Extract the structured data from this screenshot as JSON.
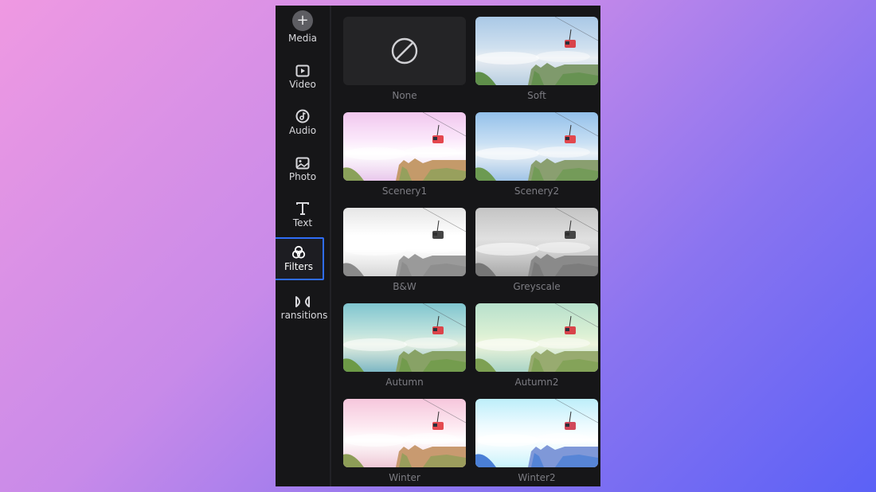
{
  "sidebar": {
    "items": [
      {
        "id": "media",
        "label": "Media",
        "icon": "plus-circle-icon"
      },
      {
        "id": "video",
        "label": "Video",
        "icon": "video-play-icon"
      },
      {
        "id": "audio",
        "label": "Audio",
        "icon": "music-note-icon"
      },
      {
        "id": "photo",
        "label": "Photo",
        "icon": "image-icon"
      },
      {
        "id": "text",
        "label": "Text",
        "icon": "text-t-icon"
      },
      {
        "id": "filters",
        "label": "Filters",
        "icon": "filters-circles-icon",
        "active": true
      },
      {
        "id": "transitions",
        "label": "Transitions",
        "display": "ransitions",
        "icon": "bowtie-transition-icon"
      }
    ],
    "active_color": "#2f6df6"
  },
  "filters": [
    {
      "label": "None",
      "icon": "no-filter-icon"
    },
    {
      "label": "Soft"
    },
    {
      "label": "Scenery1"
    },
    {
      "label": "Scenery2"
    },
    {
      "label": "B&W"
    },
    {
      "label": "Greyscale"
    },
    {
      "label": "Autumn"
    },
    {
      "label": "Autumn2"
    },
    {
      "label": "Winter"
    },
    {
      "label": "Winter2"
    }
  ]
}
